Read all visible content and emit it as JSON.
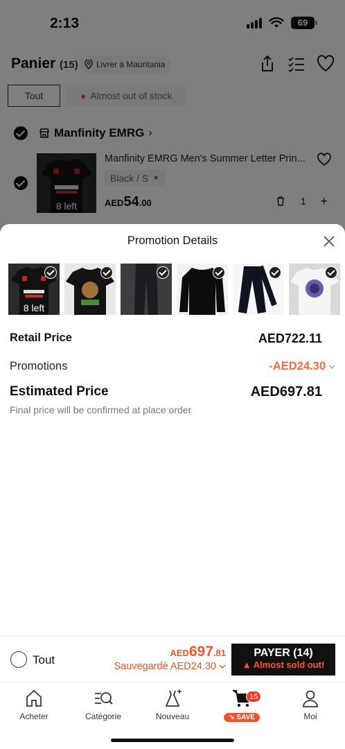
{
  "status_bar": {
    "time": "2:13",
    "battery": "69"
  },
  "header": {
    "title": "Panier",
    "count": "(15)",
    "deliver_label": "Livrer à Mauritania"
  },
  "filters": {
    "all": "Tout",
    "almost_out": "Almost out of stock"
  },
  "store": {
    "name": "Manfinity EMRG",
    "product": {
      "title": "Manfinity EMRG Men's Summer Letter Prin...",
      "variant": "Black / S",
      "stock_left": "8 left",
      "price_currency": "AED",
      "price_int": "54",
      "price_dec": ".00",
      "quantity": "1"
    }
  },
  "promotion_sheet": {
    "title": "Promotion Details",
    "first_thumb_stock": "8 left",
    "retail_label": "Retail Price",
    "retail_value": "AED722.11",
    "promotions_label": "Promotions",
    "promotions_value": "-AED24.30",
    "estimated_label": "Estimated Price",
    "estimated_value": "AED697.81",
    "note": "Final price will be confirmed at place order"
  },
  "checkout": {
    "select_all": "Tout",
    "total_currency": "AED",
    "total_int": "697",
    "total_dec": ".81",
    "saved": "Sauvegardé AED24.30",
    "pay_label": "PAYER (14)",
    "pay_sub": "Almost sold out!"
  },
  "tabbar": {
    "items": [
      {
        "label": "Acheter",
        "icon": "home-icon"
      },
      {
        "label": "Catégorie",
        "icon": "category-search-icon"
      },
      {
        "label": "Nouveau",
        "icon": "dress-sparkle-icon"
      },
      {
        "label": "SAVE",
        "icon": "cart-icon",
        "badge": "15"
      },
      {
        "label": "Moi",
        "icon": "user-icon"
      }
    ]
  },
  "colors": {
    "accent": "#f0542e",
    "dark": "#111111",
    "overlay": "rgba(0,0,0,0.5)"
  }
}
